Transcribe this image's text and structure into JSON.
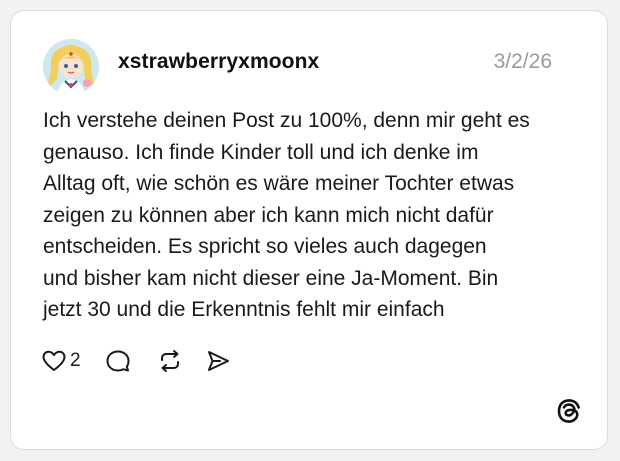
{
  "post": {
    "username": "xstrawberryxmoonx",
    "date": "3/2/26",
    "text": "Ich verstehe deinen Post zu 100%, denn mir geht es\ngenauso. Ich finde Kinder toll und ich denke im\nAlltag oft, wie schön es wäre meiner Tochter etwas\nzeigen zu können aber ich kann mich nicht dafür\nentscheiden. Es spricht so vieles auch dagegen\nund bisher kam nicht dieser eine Ja-Moment.  Bin\njetzt 30 und die Erkenntnis fehlt mir einfach",
    "like_count": "2"
  },
  "icons": {
    "like": "heart-icon",
    "comment": "comment-bubble-icon",
    "repost": "repost-icon",
    "share": "send-icon",
    "brand": "threads-logo-icon"
  },
  "colors": {
    "text": "#1a1a1a",
    "muted": "#9a9a9a",
    "card_border": "#dcdcdc",
    "background": "#ffffff"
  }
}
